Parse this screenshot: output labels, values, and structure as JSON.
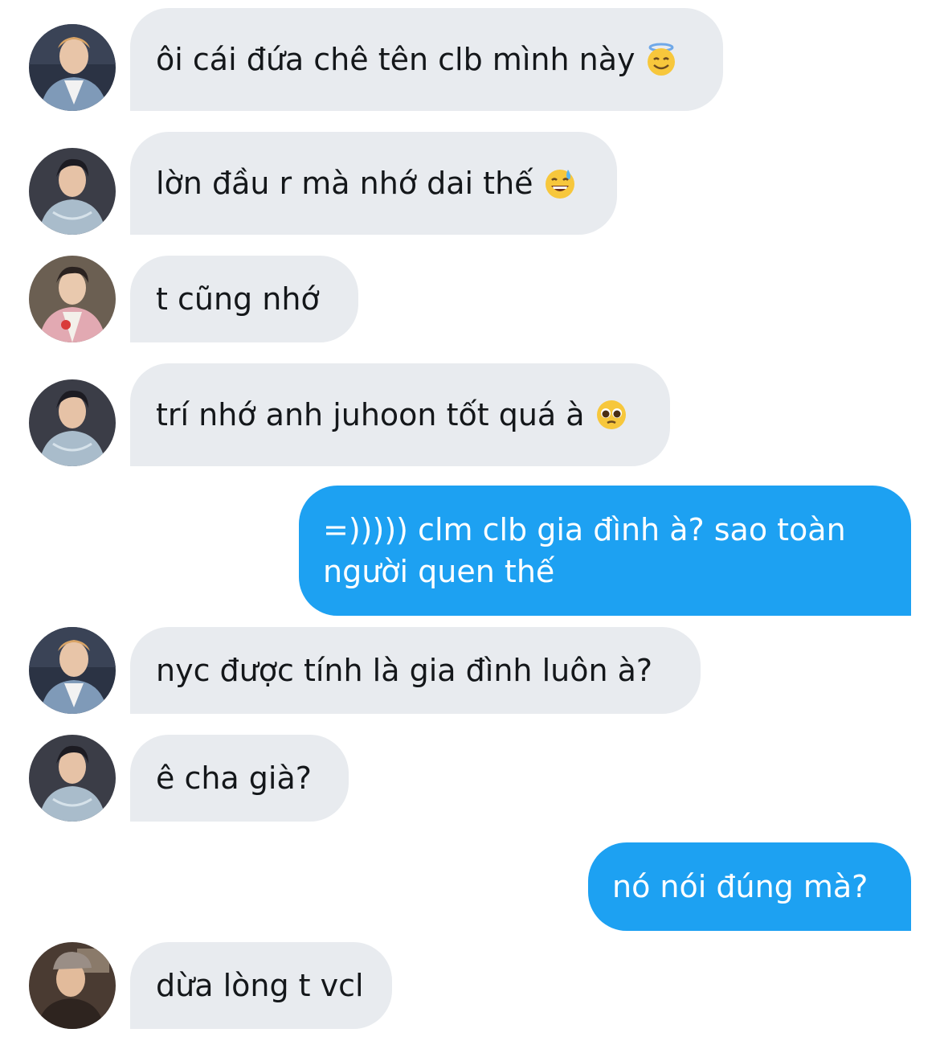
{
  "messages": [
    {
      "from": "other",
      "avatar": "user-a",
      "text": "ôi cái đứa chê tên clb mình này",
      "emoji": "smiling-face-with-halo"
    },
    {
      "from": "other",
      "avatar": "user-b",
      "text": "lờn đầu r mà nhớ dai thế",
      "emoji": "grinning-face-with-sweat"
    },
    {
      "from": "other",
      "avatar": "user-c",
      "text": "t cũng nhớ"
    },
    {
      "from": "other",
      "avatar": "user-b",
      "text": "trí nhớ anh juhoon tốt quá à",
      "emoji": "pleading-face"
    },
    {
      "from": "me",
      "text": "=))))) clm clb gia đình à? sao toàn người quen thế"
    },
    {
      "from": "other",
      "avatar": "user-a",
      "text": "nyc được tính là gia đình luôn à?"
    },
    {
      "from": "other",
      "avatar": "user-b",
      "text": "ê cha già?"
    },
    {
      "from": "me",
      "text": "nó nói đúng mà?"
    },
    {
      "from": "other",
      "avatar": "user-d",
      "text": "dừa lòng t vcl"
    }
  ],
  "colors": {
    "incoming_bubble": "#e8ebef",
    "outgoing_bubble": "#1da1f2",
    "incoming_text": "#14171a",
    "outgoing_text": "#ffffff"
  }
}
